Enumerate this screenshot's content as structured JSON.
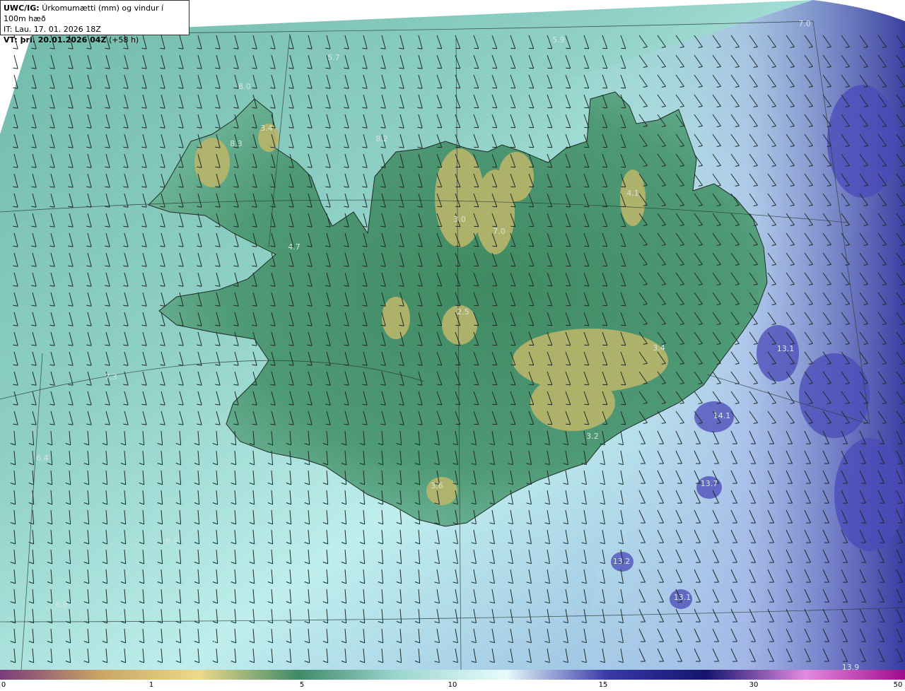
{
  "header": {
    "model": "UWC/IG:",
    "title": "Úrkomumætti (mm) og vindur í 100m hæð",
    "it_line": "IT: Lau. 17. 01. 2026 18Z",
    "vt_prefix": "VT: þri. 20.01.2026 04Z",
    "vt_offset": "(+58 h)"
  },
  "map_labels": [
    {
      "text": "5.9"
    },
    {
      "text": "5.7"
    },
    {
      "text": "7.0"
    },
    {
      "text": "8.0"
    },
    {
      "text": "3.4"
    },
    {
      "text": "8.2"
    },
    {
      "text": "8.3"
    },
    {
      "text": "4.1"
    },
    {
      "text": "3.0"
    },
    {
      "text": "7.0"
    },
    {
      "text": "4.7"
    },
    {
      "text": "2.5"
    },
    {
      "text": "3.4"
    },
    {
      "text": "13.1"
    },
    {
      "text": "7.3"
    },
    {
      "text": "14.1"
    },
    {
      "text": "6.4"
    },
    {
      "text": "3.2"
    },
    {
      "text": "3.6"
    },
    {
      "text": "13.7"
    },
    {
      "text": "6.4"
    },
    {
      "text": "13.2"
    },
    {
      "text": "6.9"
    },
    {
      "text": "13.1"
    },
    {
      "text": "6.5"
    },
    {
      "text": "13.9"
    }
  ],
  "colorbar": {
    "ticks": [
      "0",
      "1",
      "5",
      "10",
      "15",
      "30",
      "50"
    ],
    "colors": [
      "#7a3b7a",
      "#c9a565",
      "#ecd98a",
      "#3f8a68",
      "#9dd6d0",
      "#e6fbfb",
      "#3a3aa8",
      "#14146e",
      "#e28be0",
      "#a00a8a"
    ]
  }
}
